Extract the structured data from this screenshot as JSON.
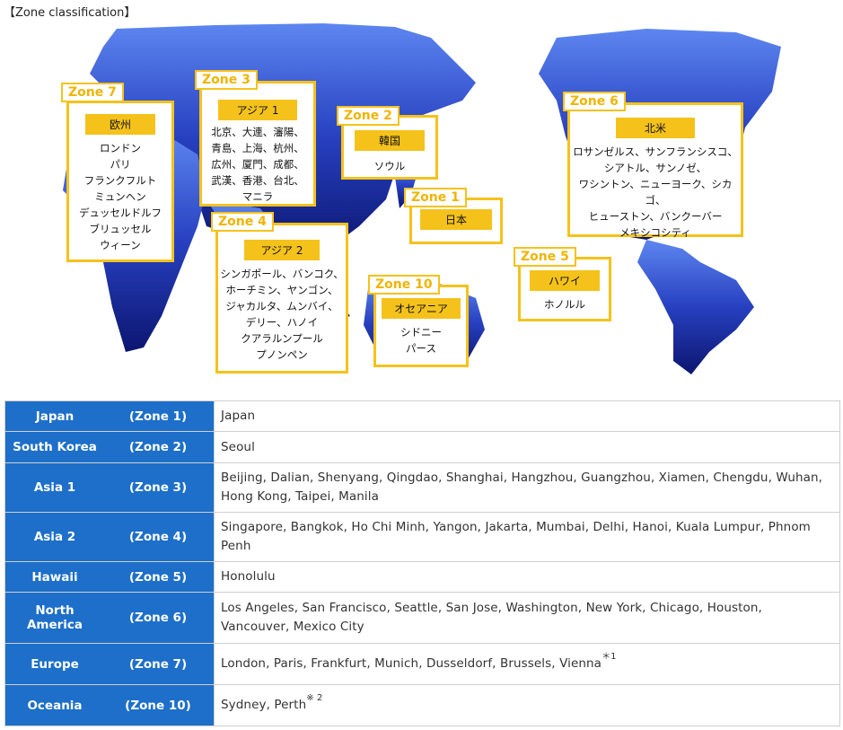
{
  "heading": "【Zone classification】",
  "map": {
    "zones": [
      {
        "tag": "Zone 1",
        "head": "日本",
        "cities": []
      },
      {
        "tag": "Zone 2",
        "head": "韓国",
        "cities": [
          "ソウル"
        ]
      },
      {
        "tag": "Zone 3",
        "head": "アジア 1",
        "cities": [
          "北京、大連、瀋陽、",
          "青島、上海、杭州、",
          "広州、厦門、成都、",
          "武漢、香港、台北、",
          "マニラ"
        ]
      },
      {
        "tag": "Zone 4",
        "head": "アジア 2",
        "cities": [
          "シンガポール、バンコク、",
          "ホーチミン、ヤンゴン、",
          "ジャカルタ、ムンバイ、",
          "デリー、ハノイ",
          "クアラルンプール",
          "プノンペン"
        ]
      },
      {
        "tag": "Zone 5",
        "head": "ハワイ",
        "cities": [
          "ホノルル"
        ]
      },
      {
        "tag": "Zone 6",
        "head": "北米",
        "cities": [
          "ロサンゼルス、サンフランシスコ、",
          "シアトル、サンノゼ、",
          "ワシントン、ニューヨーク、シカゴ、",
          "ヒューストン、バンクーバー",
          "メキシコシティ"
        ]
      },
      {
        "tag": "Zone 7",
        "head": "欧州",
        "cities": [
          "ロンドン",
          "パリ",
          "フランクフルト",
          "ミュンヘン",
          "デュッセルドルフ",
          "ブリュッセル",
          "ウィーン"
        ]
      },
      {
        "tag": "Zone 10",
        "head": "オセアニア",
        "cities": [
          "シドニー",
          "パース"
        ]
      }
    ]
  },
  "table": {
    "rows": [
      {
        "name": "Japan",
        "zone": "(Zone 1)",
        "cities": "Japan",
        "note": ""
      },
      {
        "name": "South Korea",
        "zone": "(Zone 2)",
        "cities": "Seoul",
        "note": ""
      },
      {
        "name": "Asia 1",
        "zone": "(Zone 3)",
        "cities": "Beijing, Dalian, Shenyang, Qingdao, Shanghai, Hangzhou, Guangzhou, Xiamen, Chengdu, Wuhan, Hong Kong, Taipei, Manila",
        "note": ""
      },
      {
        "name": "Asia 2",
        "zone": "(Zone 4)",
        "cities": "Singapore, Bangkok, Ho Chi Minh, Yangon, Jakarta, Mumbai, Delhi, Hanoi, Kuala Lumpur, Phnom Penh",
        "note": ""
      },
      {
        "name": "Hawaii",
        "zone": "(Zone 5)",
        "cities": "Honolulu",
        "note": ""
      },
      {
        "name": "North America",
        "zone": "(Zone 6)",
        "cities": "Los Angeles, San Francisco, Seattle, San Jose, Washington, New York, Chicago, Houston, Vancouver, Mexico City",
        "note": ""
      },
      {
        "name": "Europe",
        "zone": "(Zone 7)",
        "cities": "London, Paris, Frankfurt, Munich, Dusseldorf, Brussels, Vienna",
        "note": "＊1"
      },
      {
        "name": "Oceania",
        "zone": "(Zone 10)",
        "cities": "Sydney, Perth",
        "note": "※ 2"
      }
    ]
  },
  "colors": {
    "accent": "#f5c21b",
    "zone_cell": "#1d6fc9",
    "map_blue": "#1a2f9e"
  }
}
